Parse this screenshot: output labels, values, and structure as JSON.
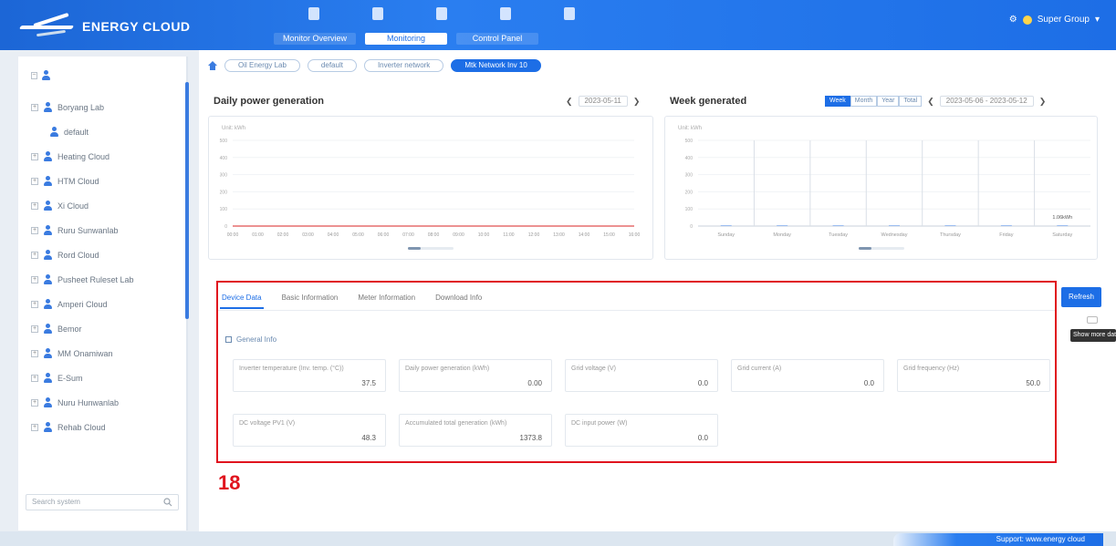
{
  "app": {
    "logo_small": "",
    "logo_text": "ENERGY CLOUD",
    "user_label": "Super Group"
  },
  "nav": {
    "tabs": [
      "Monitor Overview",
      "Monitoring",
      "Control Panel"
    ]
  },
  "sidebar": {
    "items": [
      {
        "label": "Boryang Lab",
        "level": 1,
        "toggle": "+"
      },
      {
        "label": "default",
        "level": 2,
        "toggle": ""
      },
      {
        "label": "Heating Cloud",
        "level": 1,
        "toggle": "+"
      },
      {
        "label": "HTM Cloud",
        "level": 1,
        "toggle": "+"
      },
      {
        "label": "Xi Cloud",
        "level": 1,
        "toggle": "+"
      },
      {
        "label": "Ruru Sunwanlab",
        "level": 1,
        "toggle": "+"
      },
      {
        "label": "Rord Cloud",
        "level": 1,
        "toggle": "+"
      },
      {
        "label": "Pusheet Ruleset Lab",
        "level": 1,
        "toggle": "+"
      },
      {
        "label": "Amperi Cloud",
        "level": 1,
        "toggle": "+"
      },
      {
        "label": "Bemor",
        "level": 1,
        "toggle": "+"
      },
      {
        "label": "MM Onamiwan",
        "level": 1,
        "toggle": "+"
      },
      {
        "label": "E-Sum",
        "level": 1,
        "toggle": "+"
      },
      {
        "label": "Nuru Hunwanlab",
        "level": 1,
        "toggle": "+"
      },
      {
        "label": "Rehab Cloud",
        "level": 1,
        "toggle": "+"
      }
    ],
    "search_placeholder": "Search system"
  },
  "breadcrumbs": [
    "Oil Energy Lab",
    "default",
    "Inverter network",
    "Mtk Network Inv 10"
  ],
  "daily": {
    "title": "Daily power generation",
    "date": "2023-05-11",
    "unit_label": "Unit: kWh"
  },
  "weekly": {
    "title": "Week generated",
    "periods": [
      "Week",
      "Month",
      "Year",
      "Total"
    ],
    "date_range": "2023-05-06 - 2023-05-12",
    "unit_label": "Unit: kWh",
    "annotation": "1.06kWh"
  },
  "chart_data": [
    {
      "type": "line",
      "title": "Daily power generation",
      "ylabel": "Unit: kWh",
      "ylim": [
        0,
        500
      ],
      "yticks": [
        "0",
        "100",
        "200",
        "300",
        "400",
        "500"
      ],
      "x": [
        "00:00",
        "01:00",
        "02:00",
        "03:00",
        "04:00",
        "05:00",
        "06:00",
        "07:00",
        "08:00",
        "09:00",
        "10:00",
        "11:00",
        "12:00",
        "13:00",
        "14:00",
        "15:00",
        "16:00"
      ],
      "series": [
        {
          "values": [
            0,
            0,
            0,
            0,
            0,
            0,
            0,
            0,
            0,
            0,
            0,
            0,
            0,
            0,
            0,
            0,
            0
          ],
          "color": "#e05050"
        }
      ]
    },
    {
      "type": "bar",
      "title": "Week generated",
      "ylabel": "Unit: kWh",
      "ylim": [
        0,
        500
      ],
      "yticks": [
        "0",
        "100",
        "200",
        "300",
        "400",
        "500"
      ],
      "categories": [
        "Sunday",
        "Monday",
        "Tuesday",
        "Wednesday",
        "Thursday",
        "Friday",
        "Saturday"
      ],
      "values": [
        0,
        0,
        0,
        0,
        0,
        0,
        1.06
      ]
    }
  ],
  "tabs": {
    "items": [
      "Device Data",
      "Basic Information",
      "Meter Information",
      "Download Info"
    ],
    "active_index": 0,
    "section_label": "General Info",
    "fields": [
      {
        "label": "Inverter temperature (Inv. temp. (°C))",
        "value": "37.5"
      },
      {
        "label": "Daily power generation (kWh)",
        "value": "0.00"
      },
      {
        "label": "Grid voltage (V)",
        "value": "0.0"
      },
      {
        "label": "Grid current (A)",
        "value": "0.0"
      },
      {
        "label": "Grid frequency (Hz)",
        "value": "50.0"
      },
      {
        "label": "DC voltage PV1 (V)",
        "value": "48.3"
      },
      {
        "label": "Accumulated total generation (kWh)",
        "value": "1373.8"
      },
      {
        "label": "DC input power (W)",
        "value": "0.0"
      }
    ]
  },
  "actions": {
    "refresh_label": "Refresh",
    "tooltip": "Show more data"
  },
  "annotation_number": "18",
  "status": {
    "label": "Support: www.energy cloud"
  }
}
